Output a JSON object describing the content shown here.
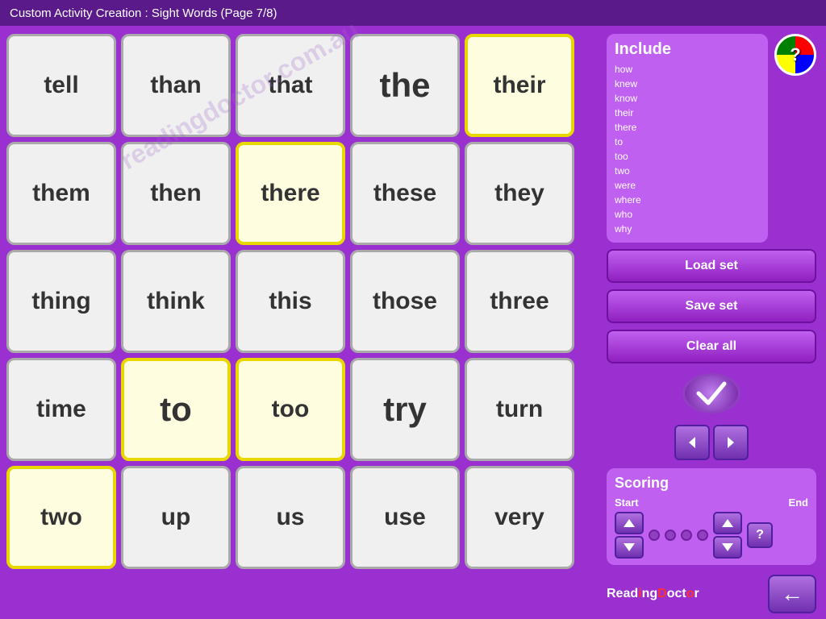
{
  "header": {
    "title": "Custom Activity Creation : Sight Words (Page 7/8)"
  },
  "grid": {
    "rows": [
      [
        {
          "word": "tell",
          "selected": false,
          "large": false
        },
        {
          "word": "than",
          "selected": false,
          "large": false
        },
        {
          "word": "that",
          "selected": false,
          "large": false
        },
        {
          "word": "the",
          "selected": false,
          "large": true
        },
        {
          "word": "their",
          "selected": true,
          "large": false
        }
      ],
      [
        {
          "word": "them",
          "selected": false,
          "large": false
        },
        {
          "word": "then",
          "selected": false,
          "large": false
        },
        {
          "word": "there",
          "selected": true,
          "large": false
        },
        {
          "word": "these",
          "selected": false,
          "large": false
        },
        {
          "word": "they",
          "selected": false,
          "large": false
        }
      ],
      [
        {
          "word": "thing",
          "selected": false,
          "large": false
        },
        {
          "word": "think",
          "selected": false,
          "large": false
        },
        {
          "word": "this",
          "selected": false,
          "large": false
        },
        {
          "word": "those",
          "selected": false,
          "large": false
        },
        {
          "word": "three",
          "selected": false,
          "large": false
        }
      ],
      [
        {
          "word": "time",
          "selected": false,
          "large": false
        },
        {
          "word": "to",
          "selected": true,
          "large": true
        },
        {
          "word": "too",
          "selected": true,
          "large": false
        },
        {
          "word": "try",
          "selected": false,
          "large": true
        },
        {
          "word": "turn",
          "selected": false,
          "large": false
        }
      ],
      [
        {
          "word": "two",
          "selected": true,
          "large": false
        },
        {
          "word": "up",
          "selected": false,
          "large": false
        },
        {
          "word": "us",
          "selected": false,
          "large": false
        },
        {
          "word": "use",
          "selected": false,
          "large": false
        },
        {
          "word": "very",
          "selected": false,
          "large": false
        }
      ]
    ]
  },
  "sidebar": {
    "include_title": "Include",
    "include_words": [
      "how",
      "knew",
      "know",
      "their",
      "there",
      "to",
      "too",
      "two",
      "were",
      "where",
      "who",
      "why"
    ],
    "help_label": "?",
    "load_set_label": "Load set",
    "save_set_label": "Save set",
    "clear_all_label": "Clear all",
    "scoring_title": "Scoring",
    "start_label": "Start",
    "end_label": "End",
    "question_label": "?",
    "logo_text": "ReadingDoctor",
    "back_arrow": "←"
  },
  "colors": {
    "background": "#9b30d0",
    "selected_border": "#e8d800",
    "panel": "#c060f0",
    "button": "#8030b8"
  }
}
